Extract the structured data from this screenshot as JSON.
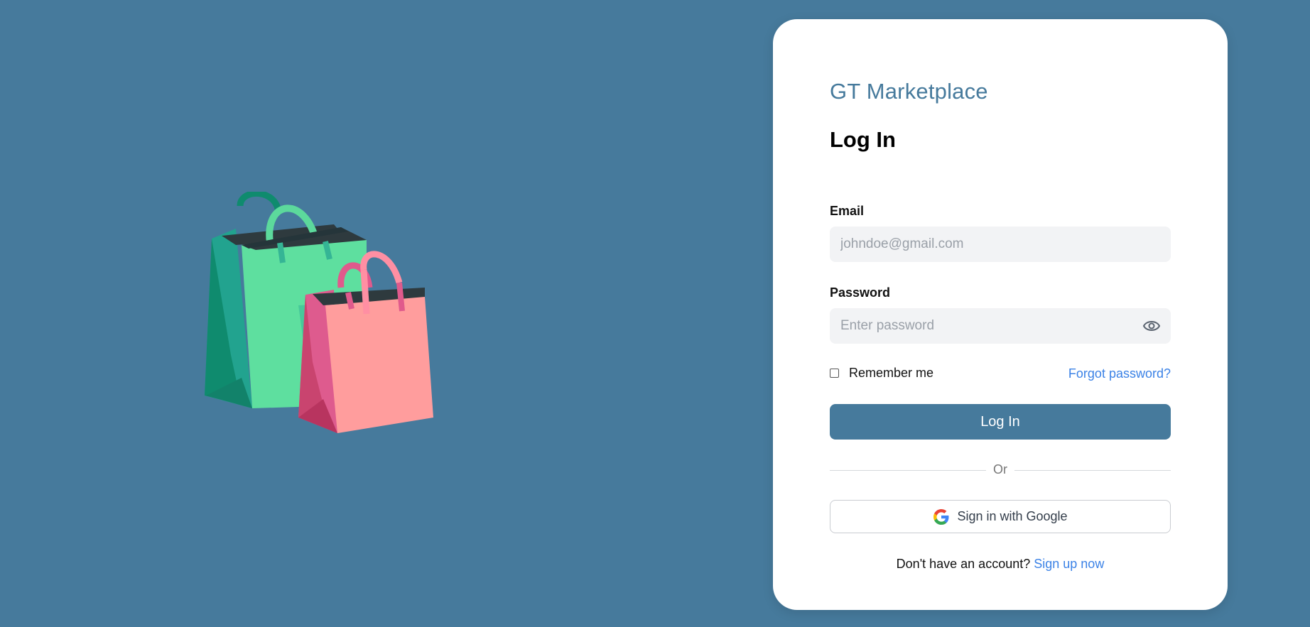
{
  "brand": {
    "name": "GT Marketplace",
    "color": "#467a9c"
  },
  "form": {
    "heading": "Log In",
    "email": {
      "label": "Email",
      "placeholder": "johndoe@gmail.com",
      "value": ""
    },
    "password": {
      "label": "Password",
      "placeholder": "Enter password",
      "value": "",
      "toggle_icon": "eye-icon"
    },
    "remember_me": {
      "label": "Remember me",
      "checked": false
    },
    "forgot_password": "Forgot password?",
    "submit_label": "Log In",
    "divider_text": "Or",
    "google_button": {
      "label": "Sign in with Google",
      "icon": "google-icon"
    },
    "signup": {
      "prompt": "Don't have an account?",
      "link": "Sign up now"
    }
  },
  "illustration": {
    "icon": "shopping-bags-icon"
  },
  "colors": {
    "background": "#467a9c",
    "card": "#ffffff",
    "primary_button": "#467a9c",
    "link": "#3b82e6"
  }
}
